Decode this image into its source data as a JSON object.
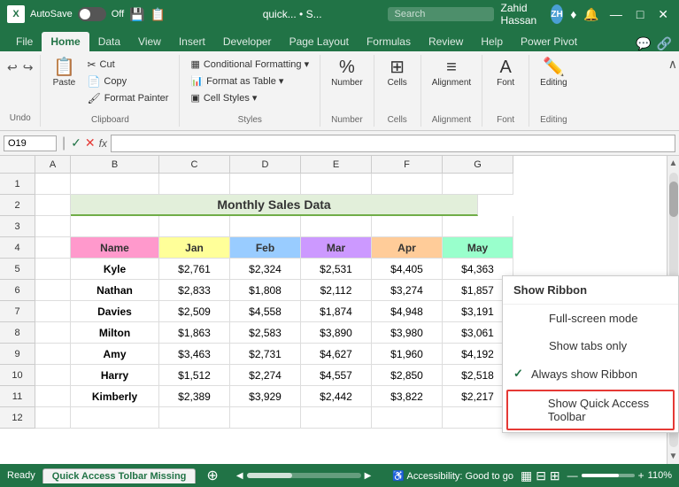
{
  "titlebar": {
    "app_icon": "X",
    "autosave_label": "AutoSave",
    "toggle_state": "Off",
    "file_name": "quick... • S...",
    "save_icon": "💾",
    "search_placeholder": "Search",
    "user_name": "Zahid Hassan",
    "minimize": "—",
    "maximize": "□",
    "close": "✕"
  },
  "ribbon": {
    "tabs": [
      "File",
      "Home",
      "Data",
      "View",
      "Insert",
      "Developer",
      "Page Layout",
      "Formulas",
      "Review",
      "Help",
      "Power Pivot"
    ],
    "active_tab": "Home",
    "groups": {
      "undo": {
        "label": "Undo"
      },
      "clipboard": {
        "label": "Clipboard",
        "paste": "Paste"
      },
      "styles": {
        "label": "Styles",
        "conditional_formatting": "Conditional Formatting ▾",
        "format_as_table": "Format as Table ▾",
        "cell_styles": "Cell Styles ▾"
      },
      "number": {
        "label": "Number"
      },
      "cells": {
        "label": "Cells"
      },
      "alignment": {
        "label": "Alignment"
      },
      "font": {
        "label": "Font"
      },
      "editing": {
        "label": "Editing"
      }
    }
  },
  "formula_bar": {
    "cell_ref": "O19",
    "fx_label": "fx"
  },
  "spreadsheet": {
    "title": "Monthly Sales Data",
    "col_headers": [
      "A",
      "B",
      "C",
      "D",
      "E",
      "F",
      "G"
    ],
    "row_headers": [
      "1",
      "2",
      "3",
      "4",
      "5",
      "6",
      "7",
      "8",
      "9",
      "10",
      "11",
      "12"
    ],
    "data_headers": [
      "Name",
      "Jan",
      "Feb",
      "Mar",
      "Apr",
      "May"
    ],
    "rows": [
      {
        "name": "Kyle",
        "jan": "$2,761",
        "feb": "$2,324",
        "mar": "$2,531",
        "apr": "$4,405",
        "may": "$4,363"
      },
      {
        "name": "Nathan",
        "jan": "$2,833",
        "feb": "$1,808",
        "mar": "$2,112",
        "apr": "$3,274",
        "may": "$1,857"
      },
      {
        "name": "Davies",
        "jan": "$2,509",
        "feb": "$4,558",
        "mar": "$1,874",
        "apr": "$4,948",
        "may": "$3,191"
      },
      {
        "name": "Milton",
        "jan": "$1,863",
        "feb": "$2,583",
        "mar": "$3,890",
        "apr": "$3,980",
        "may": "$3,061"
      },
      {
        "name": "Amy",
        "jan": "$3,463",
        "feb": "$2,731",
        "mar": "$4,627",
        "apr": "$1,960",
        "may": "$4,192"
      },
      {
        "name": "Harry",
        "jan": "$1,512",
        "feb": "$2,274",
        "mar": "$4,557",
        "apr": "$2,850",
        "may": "$2,518"
      },
      {
        "name": "Kimberly",
        "jan": "$2,389",
        "feb": "$3,929",
        "mar": "$2,442",
        "apr": "$3,822",
        "may": "$2,217"
      }
    ]
  },
  "dropdown": {
    "title": "Show Ribbon",
    "items": [
      {
        "label": "Full-screen mode",
        "checked": false
      },
      {
        "label": "Show tabs only",
        "checked": false
      },
      {
        "label": "Always show Ribbon",
        "checked": true
      },
      {
        "label": "Show Quick Access Toolbar",
        "checked": false,
        "highlighted": true
      }
    ]
  },
  "statusbar": {
    "ready": "Ready",
    "accessibility": "♿ Accessibility: Good to go",
    "sheet_tab": "Quick Access Tolbar Missing",
    "zoom": "110%"
  }
}
